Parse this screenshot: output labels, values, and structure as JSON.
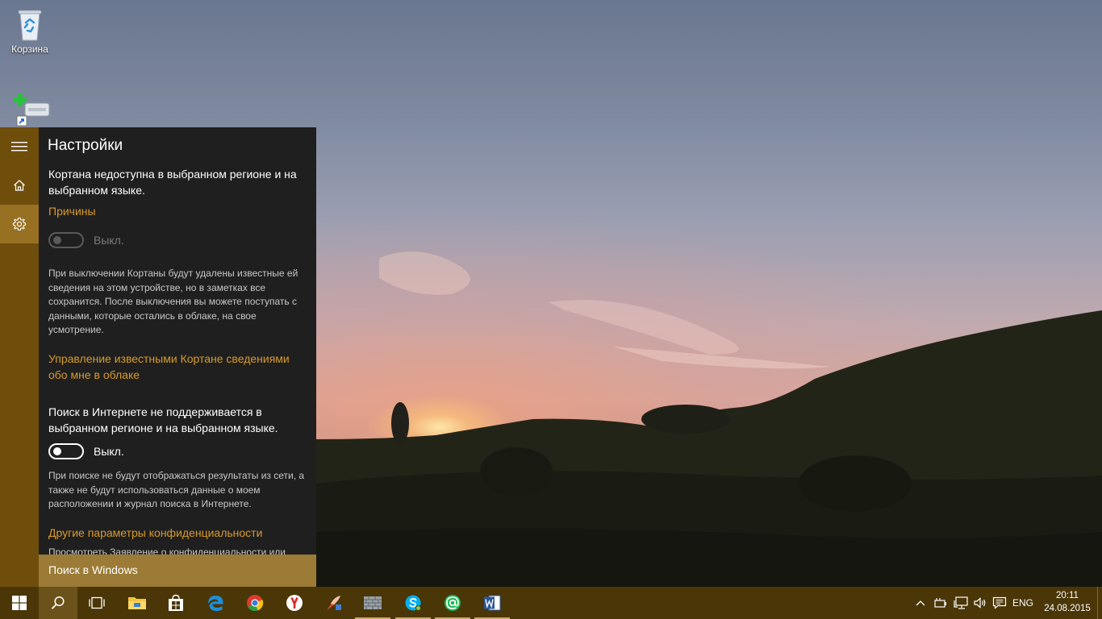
{
  "desktop": {
    "icons": [
      {
        "label": "Корзина",
        "icon": "recycle-bin-icon"
      },
      {
        "label": "",
        "icon": "add-drive-shortcut-icon"
      }
    ]
  },
  "cortana": {
    "title": "Настройки",
    "unavailable_text": "Кортана недоступна в выбранном регионе и на выбранном языке.",
    "reasons_link": "Причины",
    "cortana_toggle": {
      "state": "off",
      "label": "Выкл.",
      "enabled": false
    },
    "cortana_off_info": "При выключении Кортаны будут удалены известные ей сведения на этом устройстве, но в заметках все сохранится. После выключения вы можете поступать с данными, которые остались в облаке, на свое усмотрение.",
    "manage_link": "Управление известными Кортане сведениями обо мне в облаке",
    "web_search_text": "Поиск в Интернете не поддерживается в выбранном регионе и на выбранном языке.",
    "web_search_toggle": {
      "state": "off",
      "label": "Выкл.",
      "enabled": true
    },
    "web_search_info": "При поиске не будут отображаться результаты из сети, а также не будут использоваться данные о моем расположении и журнал поиска в Интернете.",
    "privacy_link": "Другие параметры конфиденциальности",
    "privacy_statement_partial": "Просмотреть Заявление о конфиденциальности или",
    "search_placeholder": "Поиск в Windows",
    "rail": [
      "menu-icon",
      "home-icon",
      "settings-gear-icon"
    ],
    "accent_color": "#d79b2e"
  },
  "taskbar": {
    "apps": [
      "file-explorer-icon",
      "store-icon",
      "edge-icon",
      "chrome-icon",
      "yandex-browser-icon",
      "ccleaner-icon",
      "firewall-app-icon",
      "skype-icon",
      "mail-ru-agent-icon",
      "word-icon"
    ],
    "tray": {
      "language": "ENG",
      "time": "20:11",
      "date": "24.08.2015"
    }
  },
  "colors": {
    "taskbar": "#4a3607",
    "panel_rail": "#6f4e0c",
    "search_box": "#9b7b36"
  }
}
